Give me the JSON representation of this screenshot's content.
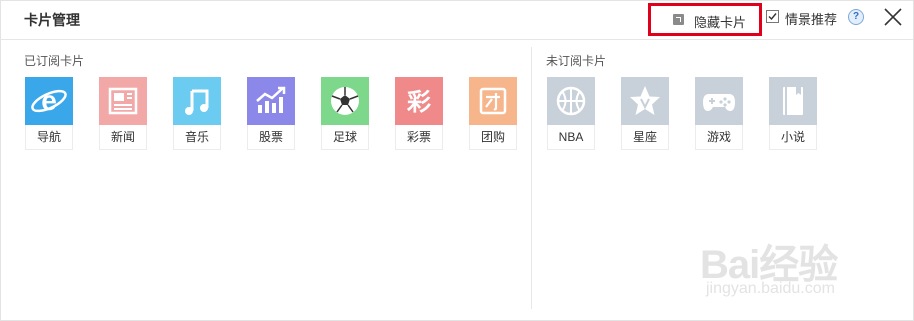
{
  "header": {
    "title": "卡片管理",
    "hide_cards_label": "隐藏卡片",
    "scene_recommend_label": "情景推荐",
    "scene_recommend_checked": true,
    "help_label": "?"
  },
  "subscribed": {
    "label": "已订阅卡片",
    "cards": [
      {
        "label": "导航",
        "icon": "ie-browser-icon",
        "color": "#3aa7ea"
      },
      {
        "label": "新闻",
        "icon": "newspaper-icon",
        "color": "#f3a8a8"
      },
      {
        "label": "音乐",
        "icon": "music-note-icon",
        "color": "#6ccbf0"
      },
      {
        "label": "股票",
        "icon": "stock-chart-icon",
        "color": "#8c88ea"
      },
      {
        "label": "足球",
        "icon": "soccer-ball-icon",
        "color": "#7ed88b"
      },
      {
        "label": "彩票",
        "icon": "lottery-icon",
        "color": "#f08a8a"
      },
      {
        "label": "团购",
        "icon": "group-buy-icon",
        "color": "#f6b58a"
      }
    ]
  },
  "unsubscribed": {
    "label": "未订阅卡片",
    "cards": [
      {
        "label": "NBA",
        "icon": "basketball-icon",
        "color": "#c8d1d9"
      },
      {
        "label": "星座",
        "icon": "star-icon",
        "color": "#c8d1d9"
      },
      {
        "label": "游戏",
        "icon": "gamepad-icon",
        "color": "#c8d1d9"
      },
      {
        "label": "小说",
        "icon": "book-icon",
        "color": "#c8d1d9"
      }
    ]
  },
  "watermark": {
    "main": "Bai经验",
    "sub": "jingyan.baidu.com"
  }
}
